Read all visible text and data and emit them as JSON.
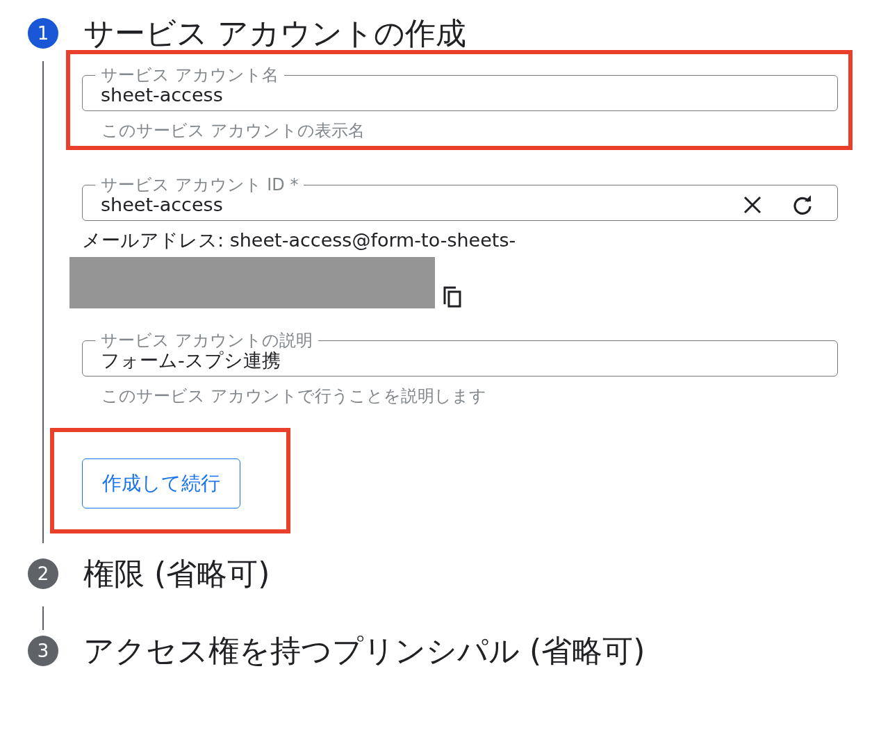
{
  "steps": [
    {
      "number": "1",
      "title": "サービス アカウントの作成",
      "active": true,
      "fields": [
        {
          "kind": "text",
          "label": "サービス アカウント名",
          "value": "sheet-access",
          "helper": "このサービス アカウントの表示名",
          "highlighted": true
        },
        {
          "kind": "id",
          "label": "サービス アカウント ID *",
          "value": "sheet-access",
          "email": "メールアドレス: sheet-access@form-to-sheets-",
          "highlighted": false
        },
        {
          "kind": "text",
          "label": "サービス アカウントの説明",
          "value": "フォーム-スプシ連携",
          "helper": "このサービス アカウントで行うことを説明します",
          "highlighted": false
        }
      ],
      "button": {
        "label": "作成して続行",
        "highlighted": true
      }
    },
    {
      "number": "2",
      "title": "権限 (省略可)",
      "active": false
    },
    {
      "number": "3",
      "title": "アクセス権を持つプリンシパル (省略可)",
      "active": false
    }
  ]
}
